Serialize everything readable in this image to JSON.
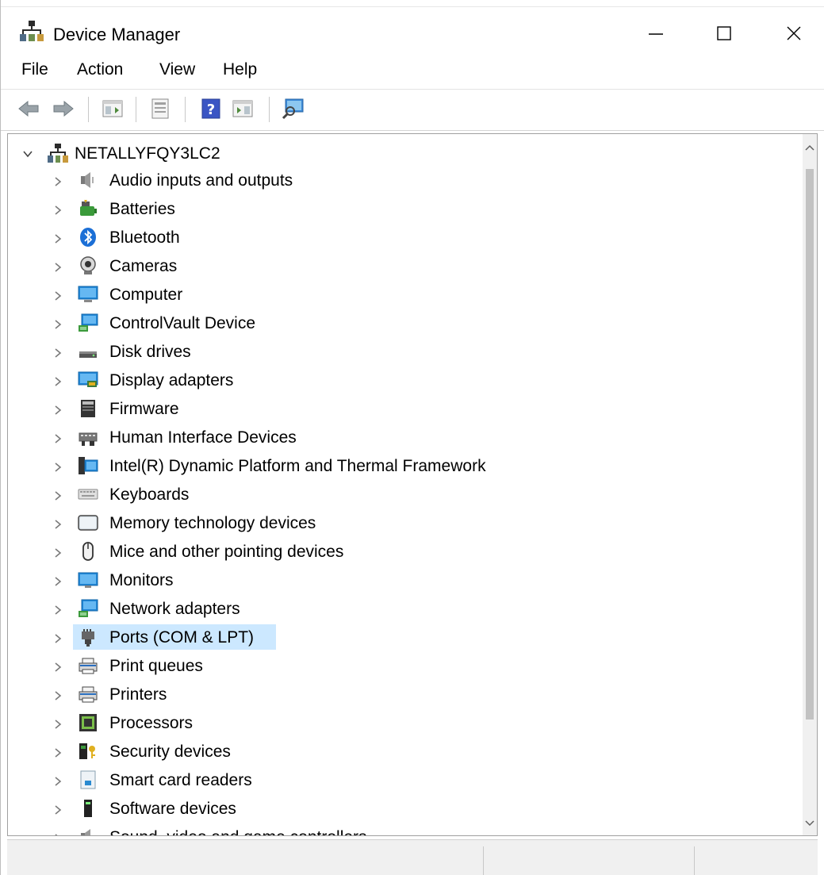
{
  "window": {
    "title": "Device Manager"
  },
  "menu": [
    "File",
    "Action",
    "View",
    "Help"
  ],
  "toolbar": {
    "buttons": [
      "back-icon",
      "forward-icon",
      "show-hide-console-tree-icon",
      "properties-icon",
      "help-icon",
      "action-pane-icon",
      "scan-hardware-icon"
    ]
  },
  "tree": {
    "root": "NETALLYFQY3LC2",
    "items": [
      {
        "label": "Audio inputs and outputs",
        "icon": "speaker-icon"
      },
      {
        "label": "Batteries",
        "icon": "battery-icon"
      },
      {
        "label": "Bluetooth",
        "icon": "bluetooth-icon"
      },
      {
        "label": "Cameras",
        "icon": "camera-icon"
      },
      {
        "label": "Computer",
        "icon": "computer-icon"
      },
      {
        "label": "ControlVault Device",
        "icon": "controlvault-icon"
      },
      {
        "label": "Disk drives",
        "icon": "disk-drive-icon"
      },
      {
        "label": "Display adapters",
        "icon": "display-adapter-icon"
      },
      {
        "label": "Firmware",
        "icon": "firmware-icon"
      },
      {
        "label": "Human Interface Devices",
        "icon": "hid-icon"
      },
      {
        "label": "Intel(R) Dynamic Platform and Thermal Framework",
        "icon": "intel-framework-icon"
      },
      {
        "label": "Keyboards",
        "icon": "keyboard-icon"
      },
      {
        "label": "Memory technology devices",
        "icon": "memory-icon"
      },
      {
        "label": "Mice and other pointing devices",
        "icon": "mouse-icon"
      },
      {
        "label": "Monitors",
        "icon": "monitor-icon"
      },
      {
        "label": "Network adapters",
        "icon": "network-adapter-icon"
      },
      {
        "label": "Ports (COM & LPT)",
        "icon": "port-icon",
        "selected": true
      },
      {
        "label": "Print queues",
        "icon": "print-queue-icon"
      },
      {
        "label": "Printers",
        "icon": "printer-icon"
      },
      {
        "label": "Processors",
        "icon": "processor-icon"
      },
      {
        "label": "Security devices",
        "icon": "security-device-icon"
      },
      {
        "label": "Smart card readers",
        "icon": "smart-card-icon"
      },
      {
        "label": "Software devices",
        "icon": "software-device-icon"
      },
      {
        "label": "Sound, video and game controllers",
        "icon": "sound-controller-icon"
      }
    ]
  },
  "colors": {
    "selection": "#cce8ff",
    "chevron": "#7a7a7a"
  }
}
